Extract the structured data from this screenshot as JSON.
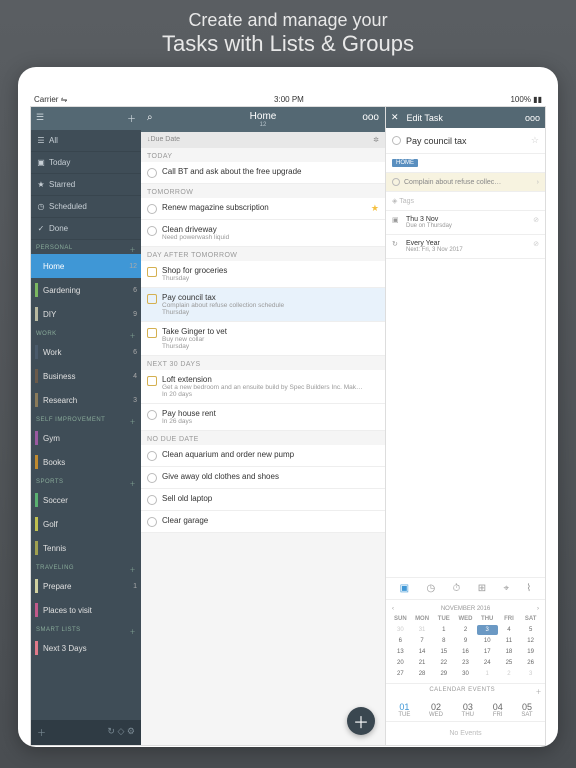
{
  "headline": {
    "l1": "Create and manage your",
    "l2a": "Tasks",
    "l2b": "with",
    "l2c": "Lists",
    "l2d": "&",
    "l2e": "Groups"
  },
  "status": {
    "left": "Carrier ⇋",
    "time": "3:00 PM",
    "right": "100% ▮▮"
  },
  "sidebar": {
    "smart": [
      {
        "icon": "☰",
        "label": "All"
      },
      {
        "icon": "▣",
        "label": "Today"
      },
      {
        "icon": "★",
        "label": "Starred"
      },
      {
        "icon": "◷",
        "label": "Scheduled"
      },
      {
        "icon": "✓",
        "label": "Done"
      }
    ],
    "groups": [
      {
        "name": "PERSONAL",
        "items": [
          {
            "label": "Home",
            "count": "12",
            "color": "#3f97d6",
            "sel": true
          },
          {
            "label": "Gardening",
            "count": "6",
            "color": "#7bb661"
          },
          {
            "label": "DIY",
            "count": "9",
            "color": "#b8b8a0"
          }
        ]
      },
      {
        "name": "WORK",
        "items": [
          {
            "label": "Work",
            "count": "6",
            "color": "#4a5a6a"
          },
          {
            "label": "Business",
            "count": "4",
            "color": "#6a5a4a"
          },
          {
            "label": "Research",
            "count": "3",
            "color": "#8a7a5a"
          }
        ]
      },
      {
        "name": "SELF IMPROVEMENT",
        "items": [
          {
            "label": "Gym",
            "count": "",
            "color": "#9a5aa0"
          },
          {
            "label": "Books",
            "count": "",
            "color": "#c08a30"
          }
        ]
      },
      {
        "name": "SPORTS",
        "items": [
          {
            "label": "Soccer",
            "count": "",
            "color": "#5ab070"
          },
          {
            "label": "Golf",
            "count": "",
            "color": "#c0c050"
          },
          {
            "label": "Tennis",
            "count": "",
            "color": "#a0a050"
          }
        ]
      },
      {
        "name": "TRAVELING",
        "items": [
          {
            "label": "Prepare",
            "count": "1",
            "color": "#d0d0a0"
          },
          {
            "label": "Places to visit",
            "count": "",
            "color": "#c05a8a"
          }
        ]
      },
      {
        "name": "SMART LISTS",
        "items": [
          {
            "label": "Next 3 Days",
            "count": "",
            "color": "#e07a8a"
          }
        ]
      }
    ]
  },
  "main": {
    "title": "Home",
    "count": "12",
    "sort": "↓Due Date",
    "sections": [
      {
        "name": "TODAY",
        "tasks": [
          {
            "title": "Call BT and ask about the free upgrade"
          }
        ]
      },
      {
        "name": "TOMORROW",
        "tasks": [
          {
            "title": "Renew magazine subscription",
            "star": true
          },
          {
            "title": "Clean driveway",
            "sub": "Need powerwash liquid"
          }
        ]
      },
      {
        "name": "DAY AFTER TOMORROW",
        "tasks": [
          {
            "title": "Shop for groceries",
            "sub": "Thursday",
            "sq": true
          },
          {
            "title": "Pay council tax",
            "sub": "Complain about refuse collection schedule\nThursday",
            "sel": true,
            "sq": true
          },
          {
            "title": "Take Ginger to vet",
            "sub": "Buy new collar\nThursday",
            "sq": true
          }
        ]
      },
      {
        "name": "NEXT 30 DAYS",
        "tasks": [
          {
            "title": "Loft extension",
            "sub": "Get a new bedroom and an ensuite build by Spec Builders Inc. Mak…\nIn 20 days",
            "sq": true
          },
          {
            "title": "Pay house rent",
            "sub": "In 26 days"
          }
        ]
      },
      {
        "name": "NO DUE DATE",
        "tasks": [
          {
            "title": "Clean aquarium and order new pump"
          },
          {
            "title": "Give away old clothes and shoes"
          },
          {
            "title": "Sell old laptop"
          },
          {
            "title": "Clear garage"
          }
        ]
      }
    ]
  },
  "panel": {
    "header": "Edit Task",
    "title": "Pay council tax",
    "tag": "HOME",
    "subtask": "Complain about refuse collec…",
    "tagPlaceholder": "Tags",
    "dates": [
      {
        "icon": "▣",
        "t": "Thu 3 Nov",
        "s": "Due on Thursday"
      },
      {
        "icon": "↻",
        "t": "Every Year",
        "s": "Next: Fri, 3 Nov 2017"
      }
    ],
    "cal": {
      "month": "NOVEMBER 2016",
      "dh": [
        "SUN",
        "MON",
        "TUE",
        "WED",
        "THU",
        "FRI",
        "SAT"
      ],
      "days": [
        [
          "30",
          "31",
          "1",
          "2",
          "3",
          "4",
          "5"
        ],
        [
          "6",
          "7",
          "8",
          "9",
          "10",
          "11",
          "12"
        ],
        [
          "13",
          "14",
          "15",
          "16",
          "17",
          "18",
          "19"
        ],
        [
          "20",
          "21",
          "22",
          "23",
          "24",
          "25",
          "26"
        ],
        [
          "27",
          "28",
          "29",
          "30",
          "1",
          "2",
          "3"
        ]
      ],
      "sel": "3"
    },
    "events": {
      "header": "CALENDAR EVENTS",
      "days": [
        {
          "n": "01",
          "d": "TUE",
          "on": true
        },
        {
          "n": "02",
          "d": "WED"
        },
        {
          "n": "03",
          "d": "THU"
        },
        {
          "n": "04",
          "d": "FRI"
        },
        {
          "n": "05",
          "d": "SAT"
        }
      ],
      "empty": "No Events"
    }
  }
}
